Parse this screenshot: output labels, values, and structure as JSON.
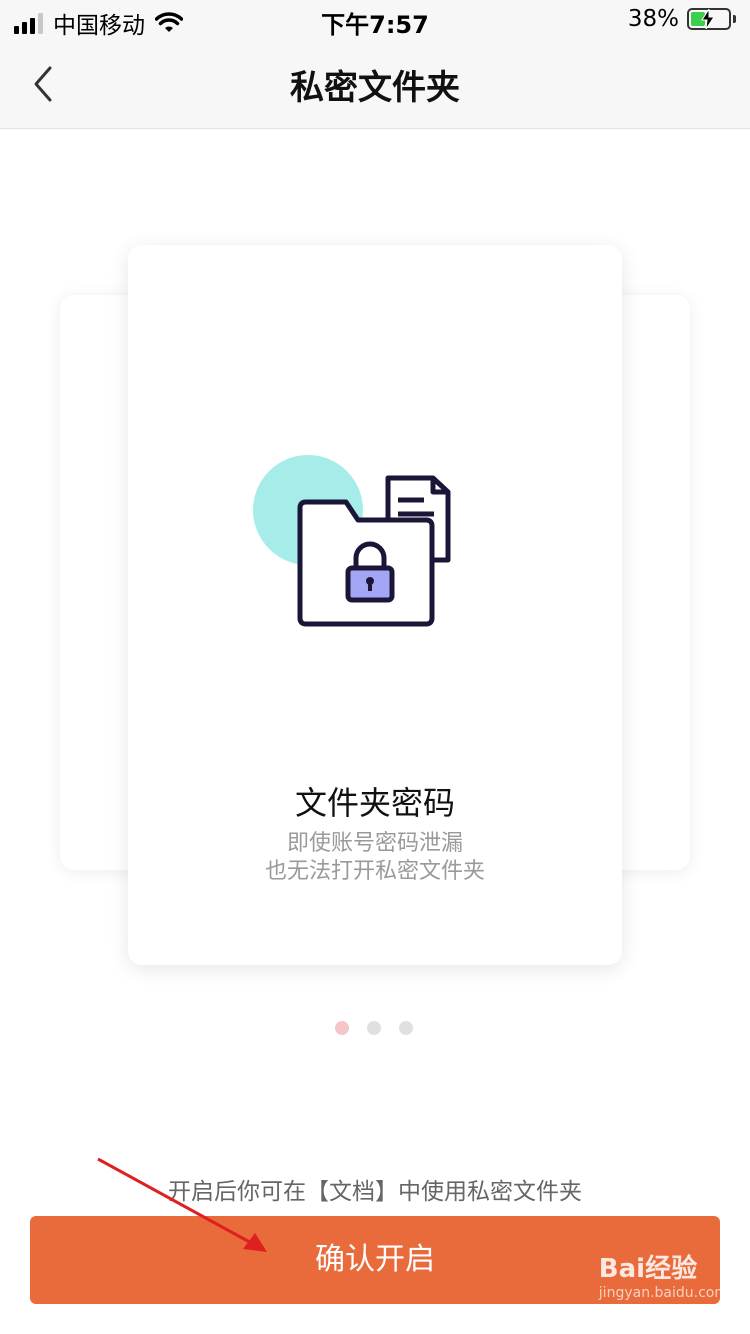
{
  "status_bar": {
    "carrier": "中国移动",
    "time": "下午7:57",
    "battery_percent": "38%",
    "battery_level": 0.38,
    "icons": [
      "signal-icon",
      "wifi-icon",
      "battery-charging-icon"
    ]
  },
  "nav": {
    "title": "私密文件夹",
    "back_icon": "chevron-left-icon"
  },
  "carousel": {
    "card_title": "文件夹密码",
    "desc_line1": "即使账号密码泄漏",
    "desc_line2": "也无法打开私密文件夹",
    "illustration_icon": "locked-folder-icon",
    "page_count": 3,
    "active_index": 0
  },
  "footer": {
    "hint": "开启后你可在【文档】中使用私密文件夹",
    "confirm_label": "确认开启"
  },
  "watermark": {
    "brand": "Bai经验",
    "sub": "jingyan.baidu.com"
  },
  "colors": {
    "accent": "#e96a3a",
    "dot_active": "#f4c6c8",
    "dot_inactive": "#e0e0e0",
    "illustration_circle": "#a6ede9",
    "lock_fill": "#a3a6f4",
    "arrow": "#e02020"
  }
}
